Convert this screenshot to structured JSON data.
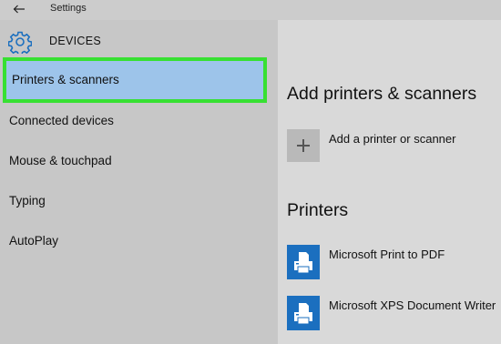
{
  "window": {
    "title": "Settings",
    "back_icon": "back-arrow-icon"
  },
  "sidebar": {
    "section_icon": "gear-icon",
    "section_title": "DEVICES",
    "items": [
      {
        "label": "Printers & scanners",
        "selected": true
      },
      {
        "label": "Connected devices"
      },
      {
        "label": "Mouse & touchpad"
      },
      {
        "label": "Typing"
      },
      {
        "label": "AutoPlay"
      }
    ],
    "highlight_color": "#37e032",
    "selected_bg": "#9dc4ea"
  },
  "main": {
    "add_heading": "Add printers & scanners",
    "add_button_label": "Add a printer or scanner",
    "add_icon": "plus-icon",
    "printers_heading": "Printers",
    "printers": [
      {
        "name": "Microsoft Print to PDF",
        "icon": "printer-icon"
      },
      {
        "name": "Microsoft XPS Document Writer",
        "icon": "printer-icon"
      }
    ],
    "accent_color": "#1b6fbf"
  }
}
